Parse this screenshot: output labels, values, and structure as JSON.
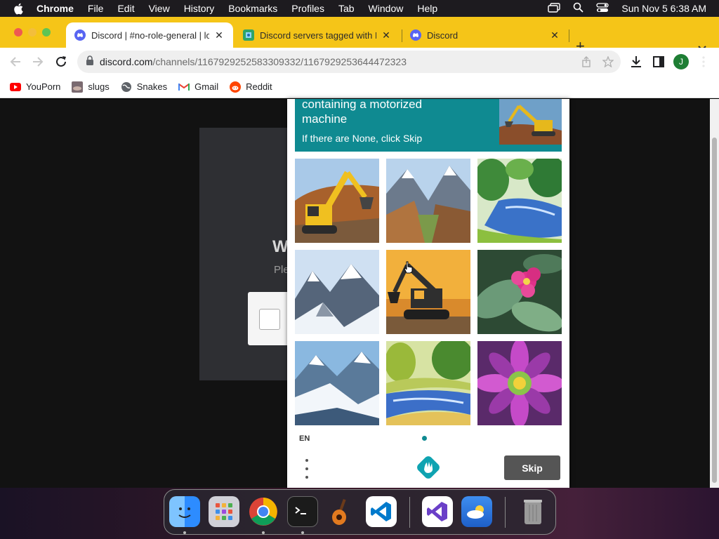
{
  "menubar": {
    "app_name": "Chrome",
    "items": [
      "File",
      "Edit",
      "View",
      "History",
      "Bookmarks",
      "Profiles",
      "Tab",
      "Window",
      "Help"
    ],
    "datetime": "Sun Nov 5  6:38 AM"
  },
  "tabs": [
    {
      "title": "Discord | #no-role-general | lo",
      "active": true,
      "icon": "discord-icon"
    },
    {
      "title": "Discord servers tagged with H",
      "active": false,
      "icon": "disboard-icon"
    },
    {
      "title": "Discord",
      "active": false,
      "icon": "discord-icon"
    }
  ],
  "address_bar": {
    "domain": "discord.com",
    "path": "/channels/1167929252583309332/1167929253644472323"
  },
  "profile": {
    "initial": "J"
  },
  "bookmarks": [
    {
      "label": "YouPorn",
      "icon": "youtube-icon"
    },
    {
      "label": "slugs",
      "icon": "slug-icon"
    },
    {
      "label": "Snakes",
      "icon": "globe-icon"
    },
    {
      "label": "Gmail",
      "icon": "gmail-icon"
    },
    {
      "label": "Reddit",
      "icon": "reddit-icon"
    }
  ],
  "page": {
    "modal_heading_fragment": "W",
    "modal_text_fragment": "Ple"
  },
  "captcha": {
    "prompt": "containing a motorized machine",
    "subtext": "If there are None, click Skip",
    "tiles": [
      {
        "subject": "excavator"
      },
      {
        "subject": "mountain valley"
      },
      {
        "subject": "river landscape"
      },
      {
        "subject": "snowy mountains"
      },
      {
        "subject": "excavator"
      },
      {
        "subject": "pink flower"
      },
      {
        "subject": "snowy mountains"
      },
      {
        "subject": "river landscape"
      },
      {
        "subject": "purple flower"
      }
    ],
    "language": "EN",
    "skip_label": "Skip",
    "accent_color": "#0f8a91"
  },
  "dock": {
    "apps": [
      "Finder",
      "Launchpad",
      "Chrome",
      "Terminal",
      "GarageBand",
      "Visual Studio Code",
      "Visual Studio",
      "Weather",
      "Trash"
    ]
  }
}
